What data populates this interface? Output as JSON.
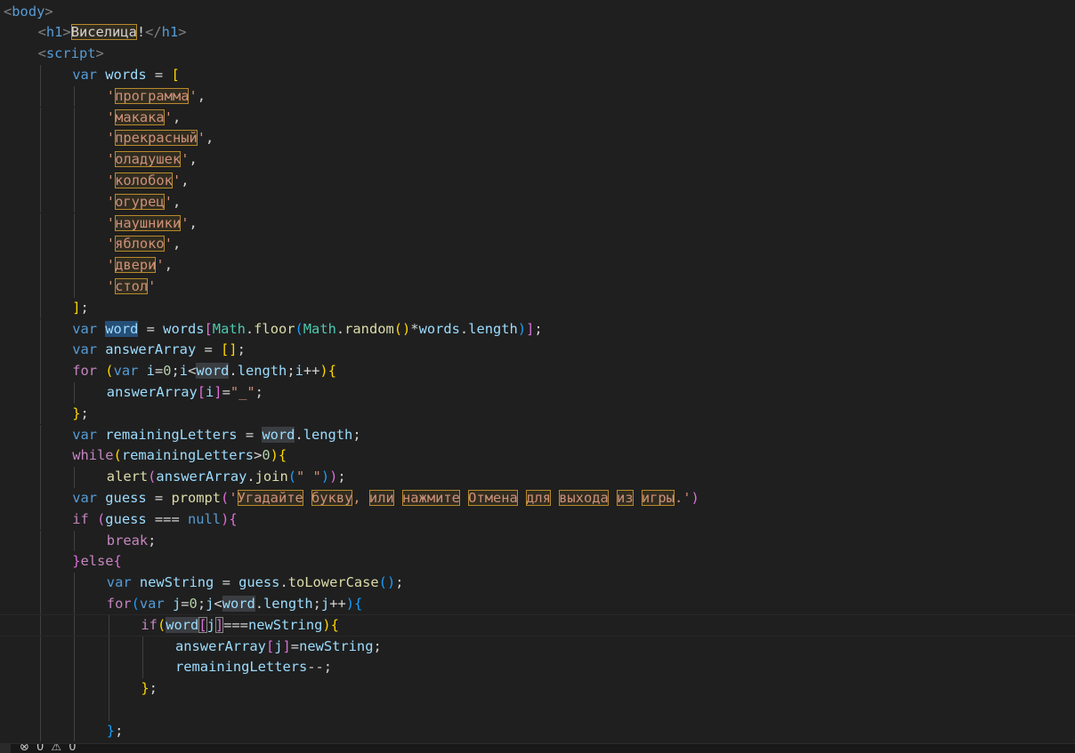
{
  "editor": {
    "lines": [
      {
        "indent": 0,
        "tokens": [
          [
            "tag",
            "<"
          ],
          [
            "tagname",
            "body"
          ],
          [
            "tag",
            ">"
          ]
        ]
      },
      {
        "indent": 1,
        "tokens": [
          [
            "tag",
            "<"
          ],
          [
            "tagname",
            "h1"
          ],
          [
            "tag",
            ">"
          ],
          [
            "txt",
            "Виселица",
            "hl"
          ],
          [
            "txt",
            "!"
          ],
          [
            "tag",
            "</"
          ],
          [
            "tagname",
            "h1"
          ],
          [
            "tag",
            ">"
          ]
        ]
      },
      {
        "indent": 1,
        "tokens": [
          [
            "tag",
            "<"
          ],
          [
            "tagname",
            "script"
          ],
          [
            "tag",
            ">"
          ]
        ]
      },
      {
        "indent": 2,
        "tokens": [
          [
            "kw",
            "var"
          ],
          [
            "txt",
            " "
          ],
          [
            "var",
            "words"
          ],
          [
            "op",
            " = "
          ],
          [
            "b1",
            "["
          ]
        ]
      },
      {
        "indent": 3,
        "tokens": [
          [
            "str",
            "'"
          ],
          [
            "str",
            "программа",
            "hl"
          ],
          [
            "str",
            "'"
          ],
          [
            "op",
            ","
          ]
        ]
      },
      {
        "indent": 3,
        "tokens": [
          [
            "str",
            "'"
          ],
          [
            "str",
            "макака",
            "hl"
          ],
          [
            "str",
            "'"
          ],
          [
            "op",
            ","
          ]
        ]
      },
      {
        "indent": 3,
        "tokens": [
          [
            "str",
            "'"
          ],
          [
            "str",
            "прекрасный",
            "hl"
          ],
          [
            "str",
            "'"
          ],
          [
            "op",
            ","
          ]
        ]
      },
      {
        "indent": 3,
        "tokens": [
          [
            "str",
            "'"
          ],
          [
            "str",
            "оладушек",
            "hl"
          ],
          [
            "str",
            "'"
          ],
          [
            "op",
            ","
          ]
        ]
      },
      {
        "indent": 3,
        "tokens": [
          [
            "str",
            "'"
          ],
          [
            "str",
            "колобок",
            "hl"
          ],
          [
            "str",
            "'"
          ],
          [
            "op",
            ","
          ]
        ]
      },
      {
        "indent": 3,
        "tokens": [
          [
            "str",
            "'"
          ],
          [
            "str",
            "огурец",
            "hl"
          ],
          [
            "str",
            "'"
          ],
          [
            "op",
            ","
          ]
        ]
      },
      {
        "indent": 3,
        "tokens": [
          [
            "str",
            "'"
          ],
          [
            "str",
            "наушники",
            "hl"
          ],
          [
            "str",
            "'"
          ],
          [
            "op",
            ","
          ]
        ]
      },
      {
        "indent": 3,
        "tokens": [
          [
            "str",
            "'"
          ],
          [
            "str",
            "яблоко",
            "hl"
          ],
          [
            "str",
            "'"
          ],
          [
            "op",
            ","
          ]
        ]
      },
      {
        "indent": 3,
        "tokens": [
          [
            "str",
            "'"
          ],
          [
            "str",
            "двери",
            "hl"
          ],
          [
            "str",
            "'"
          ],
          [
            "op",
            ","
          ]
        ]
      },
      {
        "indent": 3,
        "tokens": [
          [
            "str",
            "'"
          ],
          [
            "str",
            "стол",
            "hl"
          ],
          [
            "str",
            "'"
          ]
        ]
      },
      {
        "indent": 2,
        "tokens": [
          [
            "b1",
            "]"
          ],
          [
            "op",
            ";"
          ]
        ]
      },
      {
        "indent": 2,
        "tokens": [
          [
            "kw",
            "var"
          ],
          [
            "txt",
            " "
          ],
          [
            "var",
            "word",
            "hl-sel"
          ],
          [
            "op",
            " = "
          ],
          [
            "var",
            "words"
          ],
          [
            "b2",
            "["
          ],
          [
            "cls",
            "Math"
          ],
          [
            "op",
            "."
          ],
          [
            "fn",
            "floor"
          ],
          [
            "b3",
            "("
          ],
          [
            "cls",
            "Math"
          ],
          [
            "op",
            "."
          ],
          [
            "fn",
            "random"
          ],
          [
            "b1",
            "()"
          ],
          [
            "op",
            "*"
          ],
          [
            "var",
            "words"
          ],
          [
            "op",
            "."
          ],
          [
            "var",
            "length"
          ],
          [
            "b3",
            ")"
          ],
          [
            "b2",
            "]"
          ],
          [
            "op",
            ";"
          ]
        ]
      },
      {
        "indent": 2,
        "tokens": [
          [
            "kw",
            "var"
          ],
          [
            "txt",
            " "
          ],
          [
            "var",
            "answerArray"
          ],
          [
            "op",
            " = "
          ],
          [
            "b1",
            "[]"
          ],
          [
            "op",
            ";"
          ]
        ]
      },
      {
        "indent": 2,
        "tokens": [
          [
            "ctl",
            "for"
          ],
          [
            "txt",
            " "
          ],
          [
            "b1",
            "("
          ],
          [
            "kw",
            "var"
          ],
          [
            "txt",
            " "
          ],
          [
            "var",
            "i"
          ],
          [
            "op",
            "="
          ],
          [
            "num",
            "0"
          ],
          [
            "op",
            ";"
          ],
          [
            "var",
            "i"
          ],
          [
            "op",
            "<"
          ],
          [
            "var",
            "word",
            "hl-occ"
          ],
          [
            "op",
            "."
          ],
          [
            "var",
            "length"
          ],
          [
            "op",
            ";"
          ],
          [
            "var",
            "i"
          ],
          [
            "op",
            "++"
          ],
          [
            "b1",
            ")"
          ],
          [
            "b1",
            "{"
          ]
        ]
      },
      {
        "indent": 3,
        "tokens": [
          [
            "var",
            "answerArray"
          ],
          [
            "b2",
            "["
          ],
          [
            "var",
            "i"
          ],
          [
            "b2",
            "]"
          ],
          [
            "op",
            "="
          ],
          [
            "str",
            "\"_\""
          ],
          [
            "op",
            ";"
          ]
        ]
      },
      {
        "indent": 2,
        "tokens": [
          [
            "b1",
            "}"
          ],
          [
            "op",
            ";"
          ]
        ]
      },
      {
        "indent": 2,
        "tokens": [
          [
            "kw",
            "var"
          ],
          [
            "txt",
            " "
          ],
          [
            "var",
            "remainingLetters"
          ],
          [
            "op",
            " = "
          ],
          [
            "var",
            "word",
            "hl-occ"
          ],
          [
            "op",
            "."
          ],
          [
            "var",
            "length"
          ],
          [
            "op",
            ";"
          ]
        ]
      },
      {
        "indent": 2,
        "tokens": [
          [
            "ctl",
            "while"
          ],
          [
            "b1",
            "("
          ],
          [
            "var",
            "remainingLetters"
          ],
          [
            "op",
            ">"
          ],
          [
            "num",
            "0"
          ],
          [
            "b1",
            ")"
          ],
          [
            "b1",
            "{"
          ]
        ]
      },
      {
        "indent": 3,
        "tokens": [
          [
            "fn",
            "alert"
          ],
          [
            "b2",
            "("
          ],
          [
            "var",
            "answerArray"
          ],
          [
            "op",
            "."
          ],
          [
            "fn",
            "join"
          ],
          [
            "b3",
            "("
          ],
          [
            "str",
            "\" \""
          ],
          [
            "b3",
            ")"
          ],
          [
            "b2",
            ")"
          ],
          [
            "op",
            ";"
          ]
        ]
      },
      {
        "indent": 2,
        "tokens": [
          [
            "kw",
            "var"
          ],
          [
            "txt",
            " "
          ],
          [
            "var",
            "guess"
          ],
          [
            "op",
            " = "
          ],
          [
            "fn",
            "prompt"
          ],
          [
            "b2",
            "("
          ],
          [
            "str",
            "'"
          ],
          [
            "str",
            "Угадайте",
            "hl"
          ],
          [
            "str",
            " "
          ],
          [
            "str",
            "букву",
            "hl"
          ],
          [
            "str",
            ", "
          ],
          [
            "str",
            "или",
            "hl"
          ],
          [
            "str",
            " "
          ],
          [
            "str",
            "нажмите",
            "hl"
          ],
          [
            "str",
            " "
          ],
          [
            "str",
            "Отмена",
            "hl"
          ],
          [
            "str",
            " "
          ],
          [
            "str",
            "для",
            "hl"
          ],
          [
            "str",
            " "
          ],
          [
            "str",
            "выхода",
            "hl"
          ],
          [
            "str",
            " "
          ],
          [
            "str",
            "из",
            "hl"
          ],
          [
            "str",
            " "
          ],
          [
            "str",
            "игры",
            "hl"
          ],
          [
            "str",
            ".'"
          ],
          [
            "b2",
            ")"
          ]
        ]
      },
      {
        "indent": 2,
        "tokens": [
          [
            "ctl",
            "if"
          ],
          [
            "txt",
            " "
          ],
          [
            "b2",
            "("
          ],
          [
            "var",
            "guess"
          ],
          [
            "op",
            " === "
          ],
          [
            "kw",
            "null"
          ],
          [
            "b2",
            ")"
          ],
          [
            "b2",
            "{"
          ]
        ]
      },
      {
        "indent": 3,
        "tokens": [
          [
            "ctl",
            "break"
          ],
          [
            "op",
            ";"
          ]
        ]
      },
      {
        "indent": 2,
        "tokens": [
          [
            "b2",
            "}"
          ],
          [
            "ctl",
            "else"
          ],
          [
            "b2",
            "{"
          ]
        ]
      },
      {
        "indent": 3,
        "tokens": [
          [
            "kw",
            "var"
          ],
          [
            "txt",
            " "
          ],
          [
            "var",
            "newString"
          ],
          [
            "op",
            " = "
          ],
          [
            "var",
            "guess"
          ],
          [
            "op",
            "."
          ],
          [
            "fn",
            "toLowerCase"
          ],
          [
            "b3",
            "()"
          ],
          [
            "op",
            ";"
          ]
        ]
      },
      {
        "indent": 3,
        "tokens": [
          [
            "ctl",
            "for"
          ],
          [
            "b3",
            "("
          ],
          [
            "kw",
            "var"
          ],
          [
            "txt",
            " "
          ],
          [
            "var",
            "j"
          ],
          [
            "op",
            "="
          ],
          [
            "num",
            "0"
          ],
          [
            "op",
            ";"
          ],
          [
            "var",
            "j"
          ],
          [
            "op",
            "<"
          ],
          [
            "var",
            "word",
            "hl-occ"
          ],
          [
            "op",
            "."
          ],
          [
            "var",
            "length"
          ],
          [
            "op",
            ";"
          ],
          [
            "var",
            "j"
          ],
          [
            "op",
            "++"
          ],
          [
            "b3",
            ")"
          ],
          [
            "b3",
            "{"
          ]
        ]
      },
      {
        "indent": 4,
        "tokens": [
          [
            "ctl",
            "if"
          ],
          [
            "b1",
            "("
          ],
          [
            "var",
            "word",
            "hl-occ"
          ],
          [
            "b2",
            "[",
            "hl-br"
          ],
          [
            "var",
            "j"
          ],
          [
            "b2",
            "]",
            "hl-br"
          ],
          [
            "op",
            "==="
          ],
          [
            "var",
            "newString"
          ],
          [
            "b1",
            ")"
          ],
          [
            "b1",
            "{"
          ]
        ]
      },
      {
        "indent": 5,
        "tokens": [
          [
            "var",
            "answerArray"
          ],
          [
            "b2",
            "["
          ],
          [
            "var",
            "j"
          ],
          [
            "b2",
            "]"
          ],
          [
            "op",
            "="
          ],
          [
            "var",
            "newString"
          ],
          [
            "op",
            ";"
          ]
        ]
      },
      {
        "indent": 5,
        "tokens": [
          [
            "var",
            "remainingLetters"
          ],
          [
            "op",
            "--;"
          ]
        ]
      },
      {
        "indent": 4,
        "tokens": [
          [
            "b1",
            "}"
          ],
          [
            "op",
            ";"
          ]
        ]
      },
      {
        "indent": 4,
        "tokens": []
      },
      {
        "indent": 3,
        "tokens": [
          [
            "b3",
            "}"
          ],
          [
            "op",
            ";"
          ]
        ]
      }
    ],
    "current_line": 29
  },
  "statusbar": {
    "icons_text": "⊗ 0 ⚠ 0",
    "icon_names": [
      "error-icon",
      "warning-icon"
    ]
  }
}
